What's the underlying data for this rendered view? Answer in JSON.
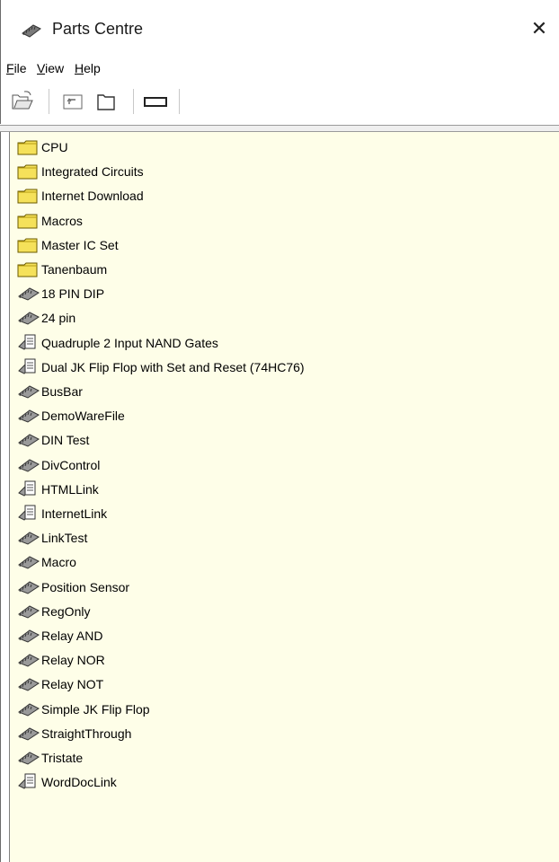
{
  "window": {
    "title": "Parts Centre",
    "close_label": "✕"
  },
  "menu": {
    "file": {
      "accel": "F",
      "rest": "ile"
    },
    "view": {
      "accel": "V",
      "rest": "iew"
    },
    "help": {
      "accel": "H",
      "rest": "elp"
    }
  },
  "toolbar": {
    "buttons": [
      "open-folder-icon",
      "up-level-icon",
      "new-folder-icon",
      "part-outline-icon"
    ]
  },
  "colors": {
    "tree_background": "#fefee8",
    "folder_yellow": "#f5e15a",
    "chip_gray": "#8a8a8a"
  },
  "tree": {
    "items": [
      {
        "label": "CPU",
        "type": "folder"
      },
      {
        "label": "Integrated Circuits",
        "type": "folder"
      },
      {
        "label": "Internet Download",
        "type": "folder"
      },
      {
        "label": "Macros",
        "type": "folder"
      },
      {
        "label": "Master IC Set",
        "type": "folder"
      },
      {
        "label": "Tanenbaum",
        "type": "folder"
      },
      {
        "label": "18 PIN DIP",
        "type": "chip"
      },
      {
        "label": "24 pin",
        "type": "chip"
      },
      {
        "label": "Quadruple 2 Input NAND Gates",
        "type": "doc"
      },
      {
        "label": "Dual JK Flip Flop with Set and Reset (74HC76)",
        "type": "doc"
      },
      {
        "label": "BusBar",
        "type": "chip"
      },
      {
        "label": "DemoWareFile",
        "type": "chip"
      },
      {
        "label": "DIN Test",
        "type": "chip"
      },
      {
        "label": "DivControl",
        "type": "chip"
      },
      {
        "label": "HTMLLink",
        "type": "doc"
      },
      {
        "label": "InternetLink",
        "type": "doc"
      },
      {
        "label": "LinkTest",
        "type": "chip"
      },
      {
        "label": "Macro",
        "type": "chip"
      },
      {
        "label": "Position Sensor",
        "type": "chip"
      },
      {
        "label": "RegOnly",
        "type": "chip"
      },
      {
        "label": "Relay AND",
        "type": "chip"
      },
      {
        "label": "Relay NOR",
        "type": "chip"
      },
      {
        "label": "Relay NOT",
        "type": "chip"
      },
      {
        "label": "Simple JK Flip Flop",
        "type": "chip"
      },
      {
        "label": "StraightThrough",
        "type": "chip"
      },
      {
        "label": "Tristate",
        "type": "chip"
      },
      {
        "label": "WordDocLink",
        "type": "doc"
      }
    ]
  }
}
